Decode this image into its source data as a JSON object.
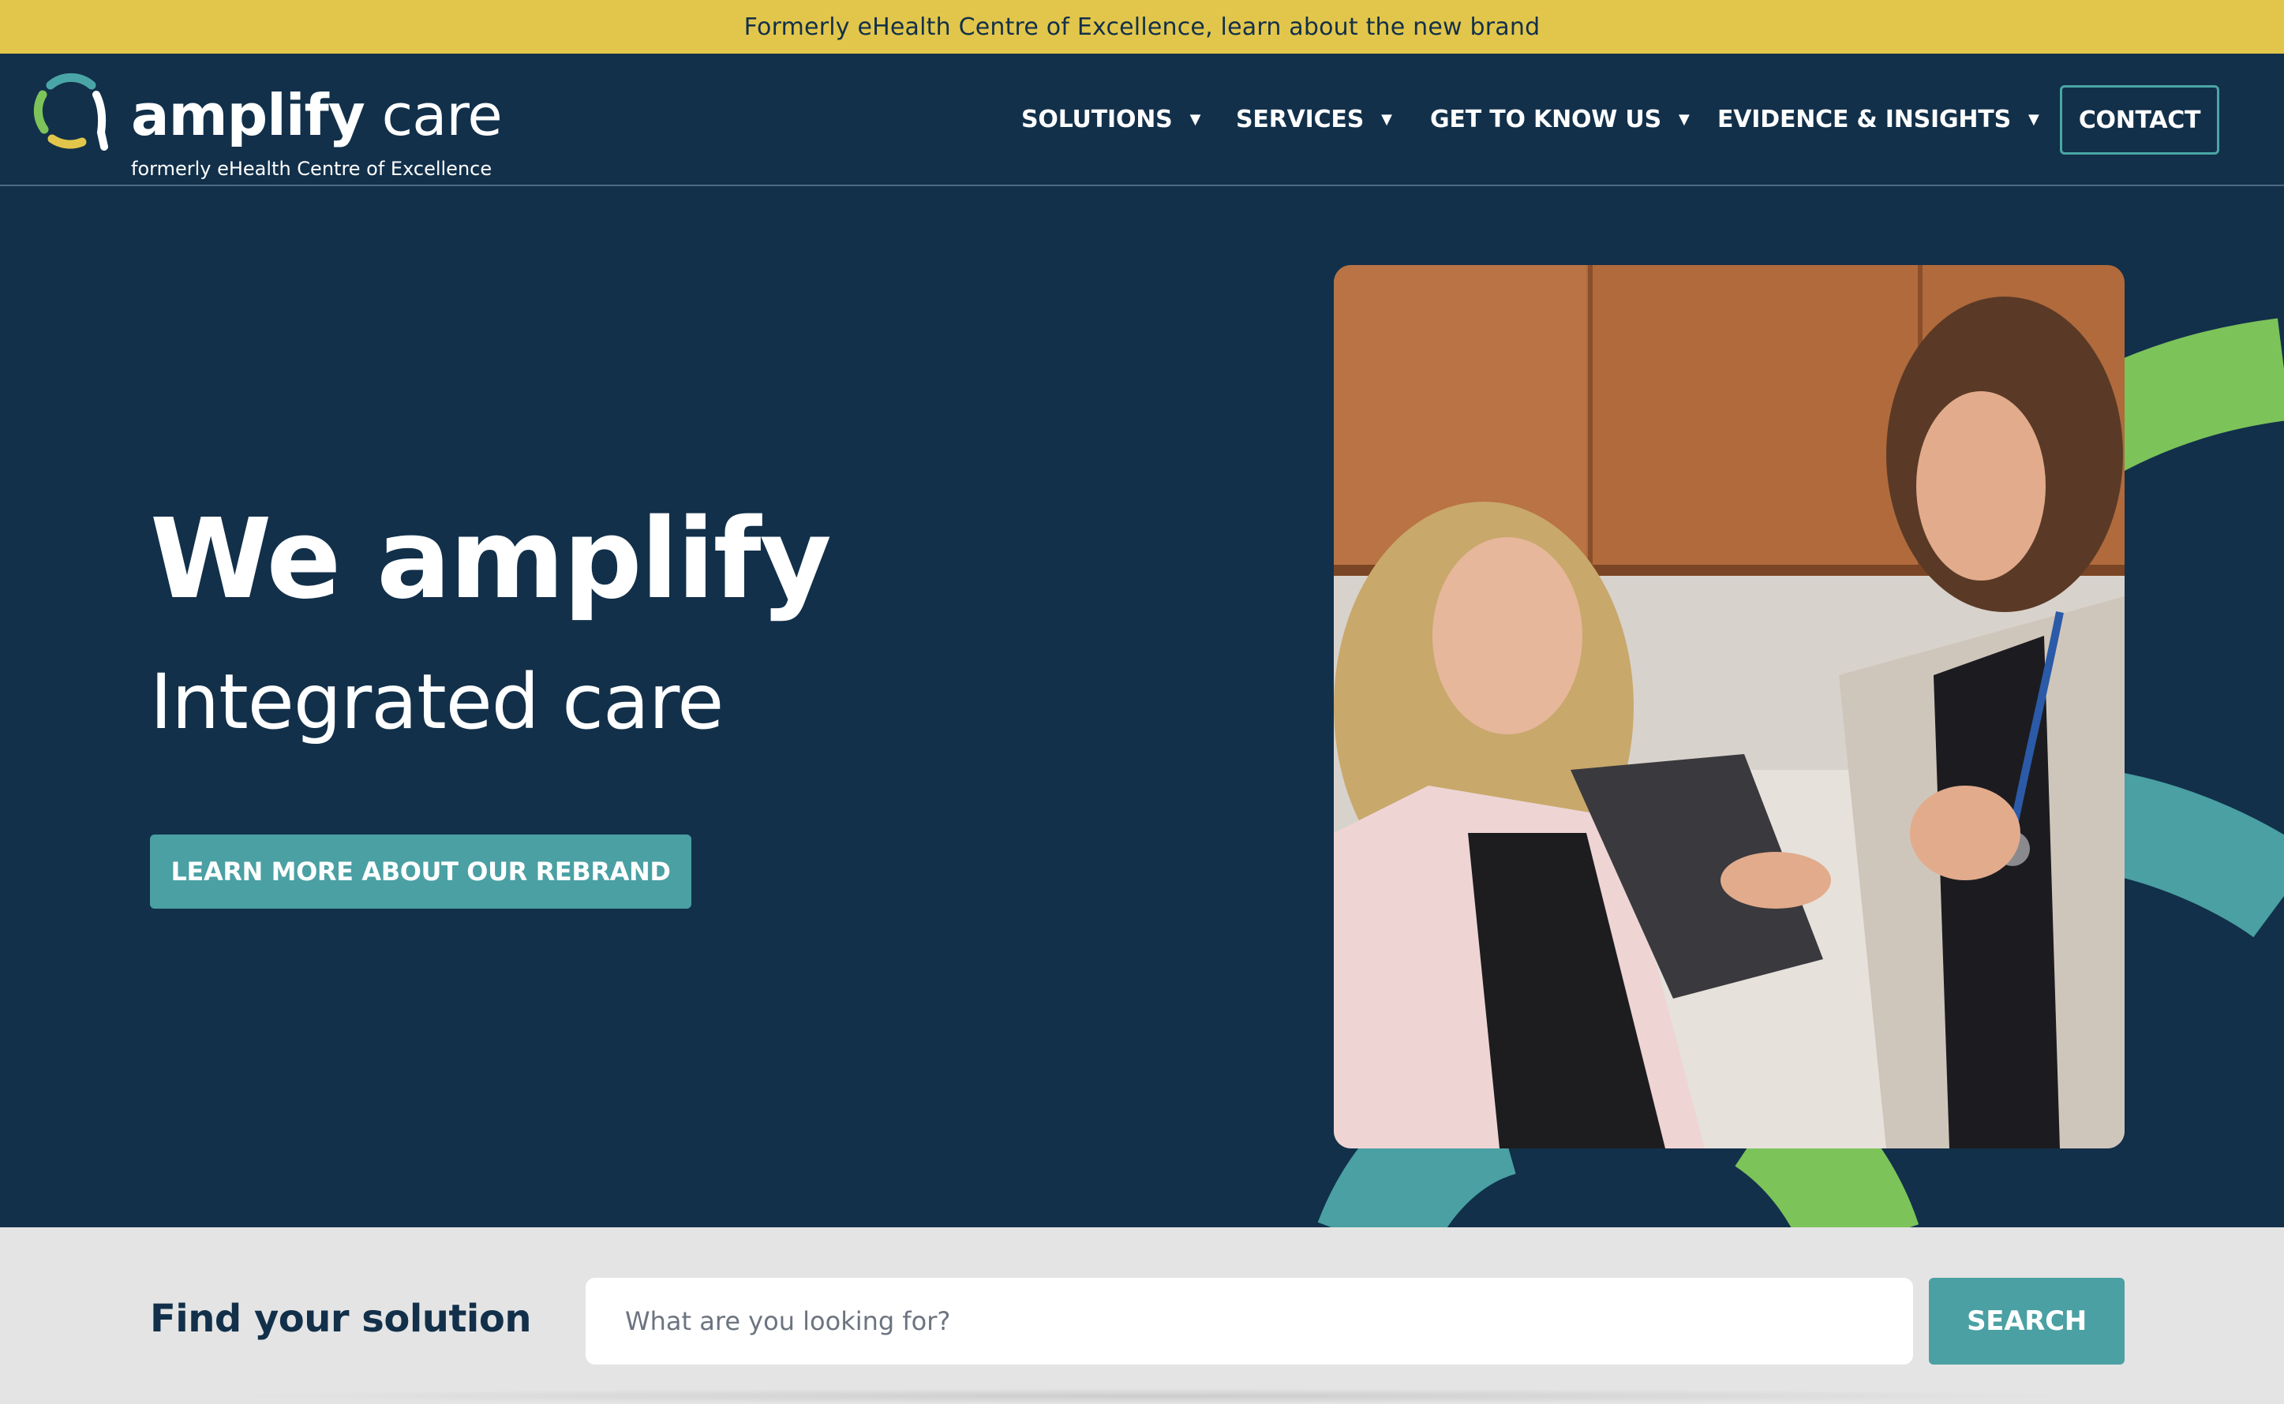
{
  "announcement": {
    "text": "Formerly eHealth Centre of Excellence, learn about the new brand"
  },
  "brand": {
    "name_bold": "amplify",
    "name_light": "care",
    "tagline": "formerly eHealth Centre of Excellence",
    "mark_colors": [
      "#4aa6a6",
      "#7cc35a",
      "#e2c64b",
      "#ffffff"
    ]
  },
  "nav": {
    "items": [
      {
        "label": "SOLUTIONS",
        "icon": "caret-down-icon"
      },
      {
        "label": "SERVICES",
        "icon": "caret-down-icon"
      },
      {
        "label": "GET TO KNOW US",
        "icon": "caret-down-icon"
      },
      {
        "label": "EVIDENCE & INSIGHTS",
        "icon": "caret-down-icon"
      }
    ],
    "contact_label": "CONTACT"
  },
  "hero": {
    "title": "We amplify",
    "subtitle": "Integrated care",
    "cta_label": "LEARN MORE ABOUT OUR REBRAND",
    "image_description": "clinician-with-tablet-talking-to-colleague-photo"
  },
  "search": {
    "label": "Find your solution",
    "placeholder": "What are you looking for?",
    "value": "",
    "button_label": "SEARCH"
  },
  "colors": {
    "navy": "#12304a",
    "teal": "#4aa0a3",
    "green": "#7cc35a",
    "yellow": "#e2c64b",
    "light_gray": "#e4e4e4"
  }
}
